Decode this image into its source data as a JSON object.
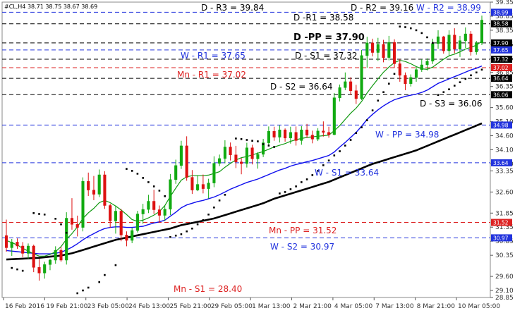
{
  "chart_data": {
    "type": "candlestick",
    "symbol_info": "#CL,H4 38.71 38.75 38.67 38.69",
    "ylim": [
      28.85,
      39.35
    ],
    "y_ticks": [
      "39.35",
      "38.85",
      "38.35",
      "37.85",
      "37.35",
      "36.85",
      "36.35",
      "35.60",
      "35.10",
      "34.60",
      "34.10",
      "33.60",
      "33.35",
      "32.60",
      "31.85",
      "31.35",
      "30.85",
      "30.35",
      "29.60",
      "29.10",
      "28.85"
    ],
    "x_ticks": [
      "16 Feb 2016",
      "19 Feb 21:00",
      "23 Feb 05:00",
      "24 Feb 13:00",
      "25 Feb 21:00",
      "29 Feb 05:00",
      "1 Mar 13:00",
      "2 Mar 21:00",
      "4 Mar 05:00",
      "7 Mar 13:00",
      "8 Mar 21:00",
      "10 Mar 05:00"
    ],
    "pivot_levels": [
      {
        "label": "D - R3 = 39.84",
        "value": 39.84,
        "color": "#000000",
        "style": "none"
      },
      {
        "label": "D - R2 = 39.16",
        "value": 39.16,
        "color": "#000000",
        "style": "none"
      },
      {
        "label": "W - R2 = 38.99",
        "value": 38.99,
        "color": "#2233dd",
        "style": "dash"
      },
      {
        "label": "D -R1 = 38.58",
        "value": 38.58,
        "color": "#000000",
        "style": "dash"
      },
      {
        "label": "D -PP = 37.90",
        "value": 37.9,
        "color": "#000000",
        "style": "dash",
        "bold": true
      },
      {
        "label": "W - R1 = 37.65",
        "value": 37.65,
        "color": "#2233dd",
        "style": "dash"
      },
      {
        "label": "D - S1 = 37.32",
        "value": 37.32,
        "color": "#000000",
        "style": "dash"
      },
      {
        "label": "Mn - R1 = 37.02",
        "value": 37.02,
        "color": "#dd2222",
        "style": "dash"
      },
      {
        "label": "D - S2 = 36.64",
        "value": 36.64,
        "color": "#000000",
        "style": "dash"
      },
      {
        "label": "D - S3 = 36.06",
        "value": 36.06,
        "color": "#000000",
        "style": "dash"
      },
      {
        "label": "W - PP = 34.98",
        "value": 34.98,
        "color": "#2233dd",
        "style": "dash"
      },
      {
        "label": "W - S1 = 33.64",
        "value": 33.64,
        "color": "#2233dd",
        "style": "dash"
      },
      {
        "label": "Mn - PP = 31.52",
        "value": 31.52,
        "color": "#dd2222",
        "style": "dash"
      },
      {
        "label": "W - S2 = 30.97",
        "value": 30.97,
        "color": "#2233dd",
        "style": "dash"
      },
      {
        "label": "Mn - S1 = 28.40",
        "value": 28.4,
        "color": "#dd2222",
        "style": "none"
      }
    ],
    "price_tags": [
      {
        "text": "38.99",
        "value": 38.99,
        "color": "#2233dd"
      },
      {
        "text": "38.58",
        "value": 38.58,
        "color": "#000000"
      },
      {
        "text": "37.90",
        "value": 37.9,
        "color": "#000000"
      },
      {
        "text": "37.65",
        "value": 37.65,
        "color": "#2233dd"
      },
      {
        "text": "37.32",
        "value": 37.32,
        "color": "#000000"
      },
      {
        "text": "37.02",
        "value": 37.02,
        "color": "#dd2222"
      },
      {
        "text": "36.64",
        "value": 36.64,
        "color": "#000000"
      },
      {
        "text": "36.06",
        "value": 36.06,
        "color": "#000000"
      },
      {
        "text": "34.98",
        "value": 34.98,
        "color": "#2233dd"
      },
      {
        "text": "33.64",
        "value": 33.64,
        "color": "#2233dd"
      },
      {
        "text": "31.52",
        "value": 31.52,
        "color": "#dd2222"
      },
      {
        "text": "30.97",
        "value": 30.97,
        "color": "#2233dd"
      }
    ],
    "candles": [
      [
        31.05,
        31.62,
        30.48,
        30.62
      ],
      [
        30.62,
        30.93,
        30.33,
        30.82
      ],
      [
        30.82,
        30.95,
        30.58,
        30.68
      ],
      [
        30.68,
        30.82,
        30.28,
        30.42
      ],
      [
        30.42,
        30.77,
        30.23,
        30.68
      ],
      [
        30.68,
        30.73,
        29.75,
        29.92
      ],
      [
        29.92,
        30.22,
        29.45,
        29.72
      ],
      [
        29.72,
        30.12,
        29.52,
        30.02
      ],
      [
        30.02,
        30.22,
        29.82,
        30.18
      ],
      [
        30.18,
        30.67,
        30.05,
        30.53
      ],
      [
        30.53,
        30.65,
        30.12,
        30.18
      ],
      [
        30.18,
        31.88,
        30.02,
        31.67
      ],
      [
        31.67,
        32.38,
        31.26,
        31.45
      ],
      [
        31.45,
        31.76,
        31.02,
        31.34
      ],
      [
        31.34,
        33.12,
        31.2,
        32.98
      ],
      [
        32.98,
        33.29,
        32.46,
        32.67
      ],
      [
        32.67,
        33.17,
        32.31,
        32.52
      ],
      [
        32.52,
        33.4,
        32.42,
        33.21
      ],
      [
        33.21,
        33.34,
        32.0,
        32.12
      ],
      [
        32.12,
        32.18,
        31.33,
        31.57
      ],
      [
        31.57,
        32.12,
        31.12,
        31.92
      ],
      [
        31.92,
        32.0,
        30.85,
        31.07
      ],
      [
        31.07,
        31.2,
        30.67,
        30.88
      ],
      [
        30.88,
        31.33,
        30.78,
        31.23
      ],
      [
        31.23,
        31.93,
        31.16,
        31.82
      ],
      [
        31.82,
        32.18,
        31.47,
        31.98
      ],
      [
        31.98,
        32.5,
        31.85,
        32.27
      ],
      [
        32.27,
        32.68,
        31.82,
        31.97
      ],
      [
        31.97,
        32.12,
        31.52,
        31.77
      ],
      [
        31.77,
        32.13,
        31.57,
        31.99
      ],
      [
        31.99,
        33.24,
        31.78,
        33.04
      ],
      [
        33.04,
        33.75,
        32.89,
        33.54
      ],
      [
        33.54,
        34.42,
        33.42,
        34.24
      ],
      [
        34.24,
        34.58,
        33.0,
        33.12
      ],
      [
        33.12,
        33.38,
        32.53,
        32.67
      ],
      [
        32.67,
        33.2,
        32.63,
        32.87
      ],
      [
        32.87,
        33.22,
        32.55,
        32.72
      ],
      [
        32.72,
        33.07,
        32.37,
        32.92
      ],
      [
        32.92,
        33.87,
        32.77,
        33.62
      ],
      [
        33.62,
        33.93,
        33.52,
        33.79
      ],
      [
        33.79,
        34.44,
        33.62,
        34.2
      ],
      [
        34.2,
        34.36,
        33.72,
        33.92
      ],
      [
        33.92,
        34.24,
        33.45,
        33.67
      ],
      [
        33.67,
        33.81,
        33.23,
        33.61
      ],
      [
        33.61,
        34.35,
        33.47,
        34.17
      ],
      [
        34.17,
        34.28,
        33.58,
        33.78
      ],
      [
        33.78,
        34.02,
        33.43,
        33.94
      ],
      [
        33.94,
        34.49,
        33.84,
        34.35
      ],
      [
        34.35,
        34.93,
        34.23,
        34.76
      ],
      [
        34.76,
        34.92,
        34.42,
        34.55
      ],
      [
        34.55,
        34.97,
        34.36,
        34.81
      ],
      [
        34.81,
        34.86,
        34.39,
        34.52
      ],
      [
        34.52,
        34.92,
        34.32,
        34.72
      ],
      [
        34.72,
        34.93,
        34.25,
        34.43
      ],
      [
        34.43,
        34.94,
        34.28,
        34.81
      ],
      [
        34.81,
        35.02,
        34.52,
        34.62
      ],
      [
        34.62,
        34.78,
        34.33,
        34.48
      ],
      [
        34.48,
        34.87,
        34.41,
        34.77
      ],
      [
        34.77,
        35.11,
        34.57,
        34.72
      ],
      [
        34.72,
        34.92,
        34.53,
        34.64
      ],
      [
        34.64,
        36.12,
        34.62,
        35.95
      ],
      [
        35.95,
        36.42,
        35.82,
        36.31
      ],
      [
        36.31,
        36.85,
        36.22,
        36.52
      ],
      [
        36.52,
        36.68,
        36.05,
        36.2
      ],
      [
        36.2,
        36.41,
        35.73,
        35.92
      ],
      [
        35.92,
        37.65,
        35.87,
        37.45
      ],
      [
        37.45,
        38.12,
        37.02,
        37.9
      ],
      [
        37.9,
        38.05,
        37.42,
        37.56
      ],
      [
        37.56,
        38.08,
        37.26,
        37.85
      ],
      [
        37.85,
        38.01,
        37.21,
        37.38
      ],
      [
        37.38,
        38.15,
        37.28,
        37.92
      ],
      [
        37.92,
        38.03,
        37.01,
        37.16
      ],
      [
        37.16,
        37.32,
        36.52,
        36.75
      ],
      [
        36.75,
        36.85,
        36.22,
        36.45
      ],
      [
        36.45,
        36.78,
        36.35,
        36.67
      ],
      [
        36.67,
        37.04,
        36.52,
        36.95
      ],
      [
        36.95,
        37.32,
        36.87,
        37.12
      ],
      [
        37.12,
        37.35,
        36.92,
        37.25
      ],
      [
        37.25,
        38.05,
        37.15,
        37.88
      ],
      [
        37.88,
        38.35,
        37.69,
        38.12
      ],
      [
        38.12,
        38.15,
        37.52,
        37.62
      ],
      [
        37.62,
        38.35,
        37.45,
        38.18
      ],
      [
        38.18,
        38.42,
        37.53,
        37.68
      ],
      [
        37.68,
        38.15,
        37.4,
        37.98
      ],
      [
        37.98,
        38.45,
        37.72,
        38.22
      ],
      [
        38.22,
        38.32,
        37.45,
        37.58
      ],
      [
        37.58,
        37.97,
        37.48,
        37.9
      ],
      [
        37.9,
        38.87,
        37.82,
        38.71
      ]
    ],
    "sma_green": [
      30.88,
      30.8,
      30.72,
      30.6,
      30.5,
      30.4,
      30.32,
      30.32,
      30.38,
      30.48,
      30.66,
      30.92,
      31.12,
      31.36,
      31.66,
      31.86,
      32.02,
      32.22,
      32.3,
      32.22,
      32.1,
      31.96,
      31.8,
      31.62,
      31.56,
      31.6,
      31.68,
      31.78,
      31.9,
      32.12,
      32.44,
      32.74,
      33.02,
      33.14,
      33.18,
      33.18,
      33.18,
      33.2,
      33.26,
      33.32,
      33.48,
      33.62,
      33.74,
      33.82,
      33.86,
      33.92,
      33.98,
      34.04,
      34.12,
      34.2,
      34.26,
      34.32,
      34.4,
      34.46,
      34.5,
      34.54,
      34.56,
      34.58,
      34.6,
      34.62,
      34.78,
      34.96,
      35.18,
      35.4,
      35.58,
      35.82,
      36.12,
      36.38,
      36.62,
      36.86,
      37.04,
      37.2,
      37.28,
      37.24,
      37.16,
      37.06,
      36.98,
      36.96,
      37.04,
      37.18,
      37.32,
      37.44,
      37.5,
      37.58,
      37.68,
      37.74,
      37.82,
      37.96
    ],
    "ema_blue": [
      30.52,
      30.5,
      30.48,
      30.46,
      30.44,
      30.42,
      30.4,
      30.4,
      30.4,
      30.42,
      30.46,
      30.54,
      30.64,
      30.76,
      30.9,
      31.02,
      31.12,
      31.22,
      31.3,
      31.34,
      31.36,
      31.36,
      31.34,
      31.34,
      31.36,
      31.38,
      31.44,
      31.5,
      31.54,
      31.6,
      31.74,
      31.88,
      32.04,
      32.14,
      32.2,
      32.26,
      32.3,
      32.36,
      32.42,
      32.5,
      32.6,
      32.7,
      32.78,
      32.86,
      32.94,
      33.0,
      33.06,
      33.14,
      33.22,
      33.3,
      33.38,
      33.44,
      33.52,
      33.58,
      33.62,
      33.68,
      33.72,
      33.78,
      33.84,
      33.9,
      34.02,
      34.2,
      34.36,
      34.54,
      34.72,
      34.94,
      35.18,
      35.36,
      35.52,
      35.66,
      35.78,
      35.88,
      35.94,
      36.0,
      36.04,
      36.08,
      36.14,
      36.22,
      36.34,
      36.46,
      36.54,
      36.62,
      36.7,
      36.78,
      36.86,
      36.94,
      37.0,
      37.08
    ],
    "ma_black": [
      30.2,
      30.21,
      30.22,
      30.23,
      30.24,
      30.25,
      30.26,
      30.28,
      30.3,
      30.32,
      30.34,
      30.38,
      30.42,
      30.48,
      30.54,
      30.6,
      30.66,
      30.72,
      30.78,
      30.84,
      30.9,
      30.94,
      30.98,
      31.02,
      31.06,
      31.1,
      31.14,
      31.18,
      31.22,
      31.26,
      31.3,
      31.36,
      31.42,
      31.46,
      31.5,
      31.54,
      31.58,
      31.62,
      31.66,
      31.72,
      31.78,
      31.84,
      31.9,
      31.96,
      32.02,
      32.08,
      32.14,
      32.2,
      32.28,
      32.36,
      32.42,
      32.48,
      32.54,
      32.6,
      32.66,
      32.72,
      32.78,
      32.84,
      32.9,
      32.96,
      33.04,
      33.12,
      33.2,
      33.28,
      33.36,
      33.44,
      33.52,
      33.6,
      33.66,
      33.72,
      33.78,
      33.84,
      33.9,
      33.96,
      34.02,
      34.08,
      34.16,
      34.24,
      34.32,
      34.4,
      34.48,
      34.56,
      34.64,
      34.72,
      34.8,
      34.88,
      34.96,
      35.04
    ],
    "sar": [
      [
        1,
        29.9
      ],
      [
        2,
        29.85
      ],
      [
        3,
        29.8
      ],
      [
        5,
        31.85
      ],
      [
        6,
        31.82
      ],
      [
        7,
        31.8
      ],
      [
        9,
        31.65
      ],
      [
        10,
        31.45
      ],
      [
        11,
        31.15
      ],
      [
        13,
        29.0
      ],
      [
        14,
        29.1
      ],
      [
        15,
        29.2
      ],
      [
        17,
        29.4
      ],
      [
        18,
        29.65
      ],
      [
        20,
        30.0
      ],
      [
        22,
        33.42
      ],
      [
        23,
        33.35
      ],
      [
        24,
        33.25
      ],
      [
        25,
        33.1
      ],
      [
        26,
        32.95
      ],
      [
        27,
        32.8
      ],
      [
        28,
        32.65
      ],
      [
        29,
        32.45
      ],
      [
        30,
        31.0
      ],
      [
        31,
        31.05
      ],
      [
        32,
        31.1
      ],
      [
        33,
        31.2
      ],
      [
        34,
        31.3
      ],
      [
        35,
        31.45
      ],
      [
        36,
        31.6
      ],
      [
        37,
        31.8
      ],
      [
        38,
        32.05
      ],
      [
        39,
        32.3
      ],
      [
        40,
        32.5
      ],
      [
        42,
        34.5
      ],
      [
        43,
        34.48
      ],
      [
        44,
        34.45
      ],
      [
        45,
        34.42
      ],
      [
        46,
        34.4
      ],
      [
        47,
        34.3
      ],
      [
        48,
        34.25
      ],
      [
        49,
        34.2
      ],
      [
        50,
        32.55
      ],
      [
        51,
        32.6
      ],
      [
        52,
        32.7
      ],
      [
        53,
        32.8
      ],
      [
        54,
        32.95
      ],
      [
        55,
        33.05
      ],
      [
        56,
        33.2
      ],
      [
        57,
        33.35
      ],
      [
        58,
        33.55
      ],
      [
        59,
        33.72
      ],
      [
        60,
        33.9
      ],
      [
        61,
        34.05
      ],
      [
        62,
        34.25
      ],
      [
        63,
        34.45
      ],
      [
        64,
        34.7
      ],
      [
        65,
        34.9
      ],
      [
        66,
        35.15
      ],
      [
        67,
        35.5
      ],
      [
        68,
        35.85
      ],
      [
        69,
        36.15
      ],
      [
        70,
        36.45
      ],
      [
        71,
        36.8
      ],
      [
        72,
        38.48
      ],
      [
        73,
        38.46
      ],
      [
        74,
        38.42
      ],
      [
        75,
        38.35
      ],
      [
        76,
        38.25
      ],
      [
        77,
        38.1
      ],
      [
        78,
        37.9
      ],
      [
        79,
        36.05
      ],
      [
        80,
        36.15
      ],
      [
        81,
        36.25
      ],
      [
        82,
        36.38
      ],
      [
        83,
        36.5
      ],
      [
        84,
        36.62
      ],
      [
        85,
        36.75
      ],
      [
        86,
        36.85
      ],
      [
        87,
        36.95
      ]
    ]
  }
}
